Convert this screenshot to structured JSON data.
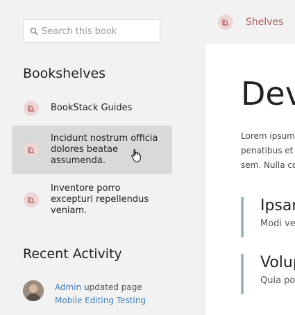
{
  "search": {
    "placeholder": "Search this book"
  },
  "sidebar": {
    "bookshelves_heading": "Bookshelves",
    "shelves": [
      {
        "label": "BookStack Guides"
      },
      {
        "label_lines": [
          "Incidunt nostrum officia",
          "dolores beatae",
          "assumenda."
        ]
      },
      {
        "label_lines": [
          "Inventore porro",
          "excepturi repellendus",
          "veniam."
        ]
      }
    ],
    "recent_activity_heading": "Recent Activity",
    "activity": {
      "user": "Admin",
      "action": "updated page",
      "page": "Mobile Editing Testing"
    }
  },
  "breadcrumb": {
    "label": "Shelves"
  },
  "main": {
    "title": "Dev",
    "intro_lines": [
      "Lorem ipsum",
      "penatibus et",
      "sem. Nulla co"
    ],
    "callouts": [
      {
        "heading": "Ipsar",
        "text": "Modi ve"
      },
      {
        "heading": "Volup",
        "text": "Quia po"
      }
    ]
  },
  "colors": {
    "accent_red": "#b05a5a",
    "link_blue": "#3f7fbf",
    "hover_bg": "#d9d9d9"
  },
  "icons": {
    "shelf": "bookshelf-icon",
    "search": "search-icon"
  }
}
